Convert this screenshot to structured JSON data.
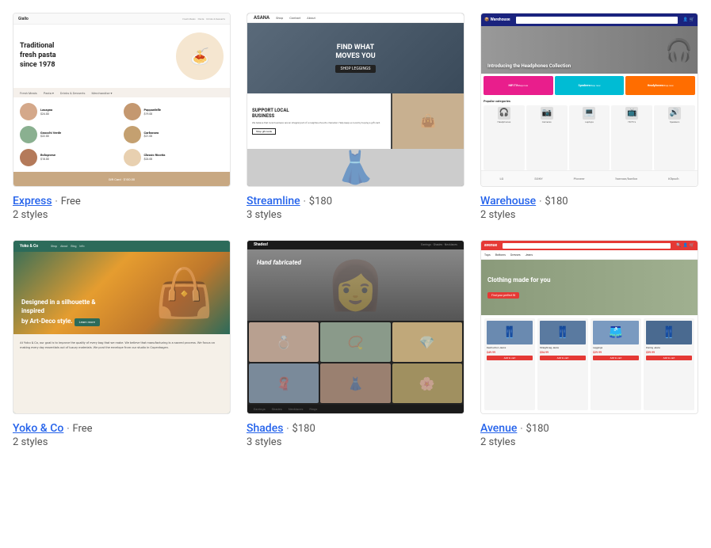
{
  "themes": [
    {
      "id": "express",
      "name": "Express",
      "price": "Free",
      "styles": "2 styles",
      "link_text": "Express",
      "preview_type": "express"
    },
    {
      "id": "streamline",
      "name": "Streamline",
      "price": "$180",
      "styles": "3 styles",
      "link_text": "Streamline",
      "preview_type": "streamline"
    },
    {
      "id": "warehouse",
      "name": "Warehouse",
      "price": "$180",
      "styles": "2 styles",
      "link_text": "Warehouse",
      "preview_type": "warehouse"
    },
    {
      "id": "yoko",
      "name": "Yoko & Co",
      "price": "Free",
      "styles": "2 styles",
      "link_text": "Yoko & Co",
      "preview_type": "yoko"
    },
    {
      "id": "shades",
      "name": "Shades",
      "price": "$180",
      "styles": "3 styles",
      "link_text": "Shades",
      "preview_type": "shades"
    },
    {
      "id": "avenue",
      "name": "Avenue",
      "price": "$180",
      "styles": "2 styles",
      "link_text": "Avenue",
      "preview_type": "avenue"
    }
  ],
  "express": {
    "logo": "Giallo",
    "hero_text": "Traditional\nfresh pasta\nsince 1978",
    "menu_items": [
      "Fresh Meals",
      "Pasta",
      "Drinks & Desserts",
      "Merchandise"
    ],
    "items": [
      {
        "name": "Lasagna",
        "price": "$24.00"
      },
      {
        "name": "Pappardelle",
        "price": "$19.00"
      },
      {
        "name": "Gnocchi Verde",
        "price": "$22.00"
      },
      {
        "name": "Carbonara Rigatoni",
        "price": "$21.00"
      },
      {
        "name": "Bolognese",
        "price": "$18.00"
      },
      {
        "name": "Classic Ricotta Ravioli",
        "price": "$23.00"
      }
    ],
    "footer": "Gift Card"
  },
  "streamline": {
    "logo": "ASANA",
    "hero_text": "FIND WHAT\nMOVES YOU",
    "cta": "Shop leggings",
    "section_title": "SUPPORT LOCAL\nBUSINESS",
    "section_text": "We believe that local business are an integral part of a neighbourhood's character. Help keep us local by buying a gift card."
  },
  "warehouse": {
    "logo": "Warehouse",
    "hero_text": "Introducing the Headphones Collection",
    "categories": [
      "HiFi TV",
      "Speakers",
      "Headphones"
    ],
    "products_label": "Popular categories",
    "product_items": [
      "Headphones",
      "Cameras",
      "Laptops",
      "HDTV's",
      "Turntables",
      "Speakers"
    ],
    "brands": [
      "LG",
      "SONY",
      "Pioneer",
      "harman/kardon",
      "Klipsch"
    ]
  },
  "yoko": {
    "logo": "Yoko & Co",
    "nav": [
      "Shop",
      "About",
      "Blog",
      "Info"
    ],
    "hero_text": "Designed in a silhouette & inspired\nby Art-Deco style.",
    "cta": "Learn more"
  },
  "shades": {
    "logo": "Shades!",
    "hero_text": "Hand fabricated",
    "bottom_nav": [
      "Earrings",
      "Shades",
      "Necklaces",
      "Rings"
    ]
  },
  "avenue": {
    "logo": "avenue",
    "nav": [
      "Tops",
      "Bottoms",
      "Dresses",
      "Jeans"
    ],
    "hero_text": "Clothing made for you",
    "cta": "Find your perfect fit",
    "product_labels": [
      "Destruction Jeans",
      "Straight-leg Jeans",
      "Leggings",
      "Flaring Jeans"
    ],
    "product_prices": [
      "$49.99",
      "$54.99",
      "$29.99",
      "$59.99"
    ]
  },
  "separator": "·"
}
